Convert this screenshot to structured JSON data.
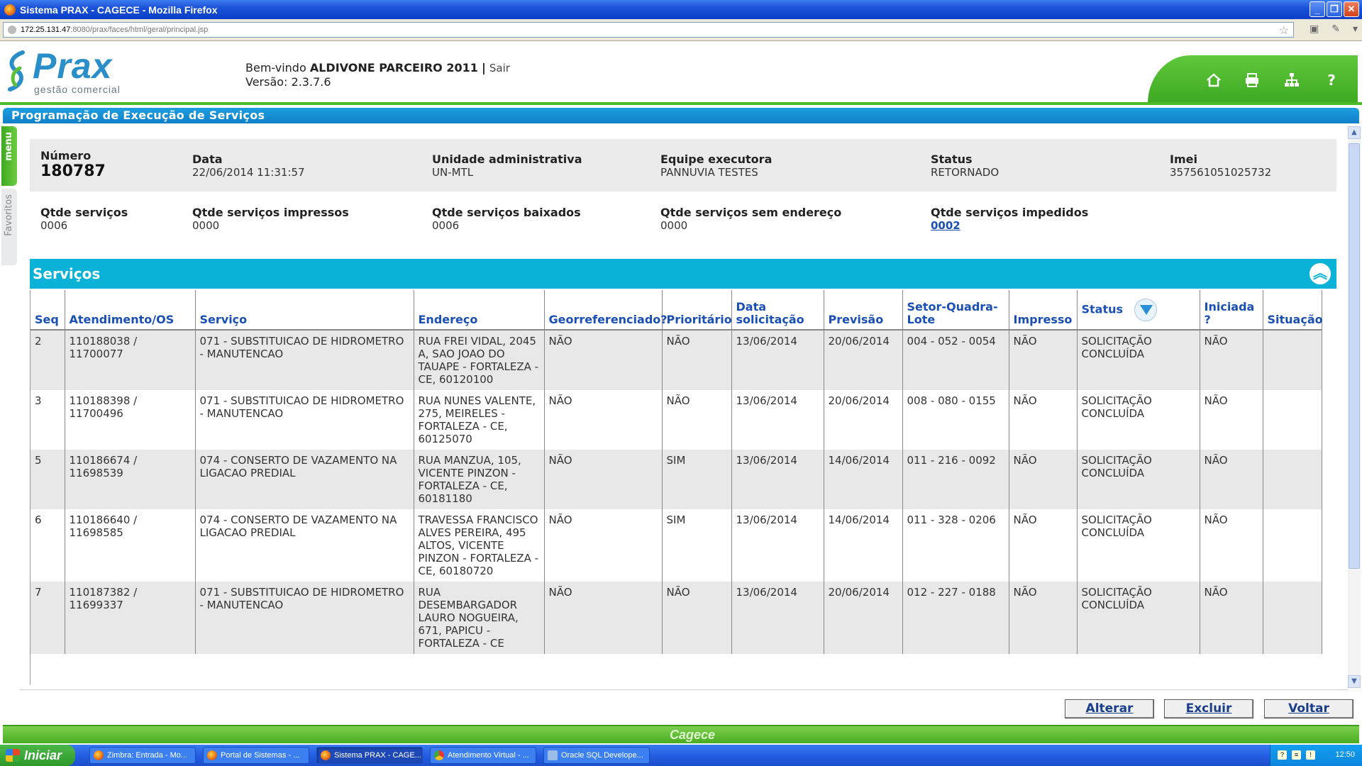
{
  "window": {
    "title": "Sistema PRAX - CAGECE - Mozilla Firefox",
    "controls": [
      "_",
      "❐",
      "✕"
    ]
  },
  "browser": {
    "url_host": "172.25.131.47",
    "url_path": ":8080/prax/faces/html/geral/principal.jsp"
  },
  "header": {
    "logo_name": "Prax",
    "logo_sub": "gestão comercial",
    "welcome_prefix": "Bem-vindo",
    "user": "ALDIVONE PARCEIRO 2011",
    "separator": "|",
    "logout": "Sair",
    "version_label": "Versão: 2.3.7.6",
    "icons": [
      "home-icon",
      "print-icon",
      "sitemap-icon",
      "help-icon"
    ],
    "help_glyph": "?"
  },
  "page": {
    "title": "Programação de Execução de Serviços"
  },
  "side": {
    "menu": "menu",
    "favorites": "Favoritos"
  },
  "info": {
    "numero": {
      "label": "Número",
      "value": "180787"
    },
    "data": {
      "label": "Data",
      "value": "22/06/2014 11:31:57"
    },
    "unidade": {
      "label": "Unidade administrativa",
      "value": "UN-MTL"
    },
    "equipe": {
      "label": "Equipe executora",
      "value": "PANNUVIA TESTES"
    },
    "status": {
      "label": "Status",
      "value": "RETORNADO"
    },
    "imei": {
      "label": "Imei",
      "value": "357561051025732"
    },
    "qtde_servicos": {
      "label": "Qtde serviços",
      "value": "0006"
    },
    "qtde_impressos": {
      "label": "Qtde serviços impressos",
      "value": "0000"
    },
    "qtde_baixados": {
      "label": "Qtde serviços baixados",
      "value": "0006"
    },
    "qtde_sem_endereco": {
      "label": "Qtde serviços sem endereço",
      "value": "0000"
    },
    "qtde_impedidos": {
      "label": "Qtde serviços impedidos",
      "value": "0002"
    }
  },
  "servicos": {
    "title": "Serviços",
    "columns": [
      "Seq",
      "Atendimento/OS",
      "Serviço",
      "Endereço",
      "Georreferenciado?",
      "Prioritário",
      "Data solicitação",
      "Previsão",
      "Setor-Quadra-Lote",
      "Impresso",
      "Status",
      "Iniciada ?",
      "Situação"
    ],
    "rows": [
      {
        "seq": "2",
        "atendimento": "110188038 / 11700077",
        "servico": "071 - SUBSTITUICAO DE HIDROMETRO - MANUTENCAO",
        "endereco": "RUA FREI VIDAL, 2045 A, SAO JOAO DO TAUAPE - FORTALEZA - CE, 60120100",
        "geo": "NÃO",
        "prioritario": "NÃO",
        "data": "13/06/2014",
        "previsao": "20/06/2014",
        "sql": "004 - 052 - 0054",
        "impresso": "NÃO",
        "status": "SOLICITAÇÃO CONCLUÍDA",
        "iniciada": "NÃO",
        "situacao": ""
      },
      {
        "seq": "3",
        "atendimento": "110188398 / 11700496",
        "servico": "071 - SUBSTITUICAO DE HIDROMETRO - MANUTENCAO",
        "endereco": "RUA NUNES VALENTE, 275, MEIRELES - FORTALEZA - CE, 60125070",
        "geo": "NÃO",
        "prioritario": "NÃO",
        "data": "13/06/2014",
        "previsao": "20/06/2014",
        "sql": "008 - 080 - 0155",
        "impresso": "NÃO",
        "status": "SOLICITAÇÃO CONCLUÍDA",
        "iniciada": "NÃO",
        "situacao": ""
      },
      {
        "seq": "5",
        "atendimento": "110186674 / 11698539",
        "servico": "074 - CONSERTO DE VAZAMENTO NA LIGACAO PREDIAL",
        "endereco": "RUA MANZUA, 105, VICENTE PINZON - FORTALEZA - CE, 60181180",
        "geo": "NÃO",
        "prioritario": "SIM",
        "data": "13/06/2014",
        "previsao": "14/06/2014",
        "sql": "011 - 216 - 0092",
        "impresso": "NÃO",
        "status": "SOLICITAÇÃO CONCLUÍDA",
        "iniciada": "NÃO",
        "situacao": ""
      },
      {
        "seq": "6",
        "atendimento": "110186640 / 11698585",
        "servico": "074 - CONSERTO DE VAZAMENTO NA LIGACAO PREDIAL",
        "endereco": "TRAVESSA FRANCISCO ALVES PEREIRA, 495 ALTOS, VICENTE PINZON - FORTALEZA - CE, 60180720",
        "geo": "NÃO",
        "prioritario": "SIM",
        "data": "13/06/2014",
        "previsao": "14/06/2014",
        "sql": "011 - 328 - 0206",
        "impresso": "NÃO",
        "status": "SOLICITAÇÃO CONCLUÍDA",
        "iniciada": "NÃO",
        "situacao": ""
      },
      {
        "seq": "7",
        "atendimento": "110187382 / 11699337",
        "servico": "071 - SUBSTITUICAO DE HIDROMETRO - MANUTENCAO",
        "endereco": "RUA DESEMBARGADOR LAURO NOGUEIRA, 671, PAPICU - FORTALEZA - CE",
        "geo": "NÃO",
        "prioritario": "NÃO",
        "data": "13/06/2014",
        "previsao": "20/06/2014",
        "sql": "012 - 227 - 0188",
        "impresso": "NÃO",
        "status": "SOLICITAÇÃO CONCLUÍDA",
        "iniciada": "NÃO",
        "situacao": ""
      }
    ]
  },
  "buttons": {
    "alterar": "Alterar",
    "excluir": "Excluir",
    "voltar": "Voltar"
  },
  "footer": {
    "brand": "Cagece"
  },
  "taskbar": {
    "start": "Iniciar",
    "tasks": [
      {
        "label": "Zimbra: Entrada - Mo...",
        "active": false
      },
      {
        "label": "Portal de Sistemas - ...",
        "active": false
      },
      {
        "label": "Sistema PRAX - CAGE...",
        "active": true
      },
      {
        "label": "Atendimento Virtual - ...",
        "active": false
      },
      {
        "label": "Oracle SQL Develope...",
        "active": false
      }
    ],
    "clock": "12:50"
  }
}
